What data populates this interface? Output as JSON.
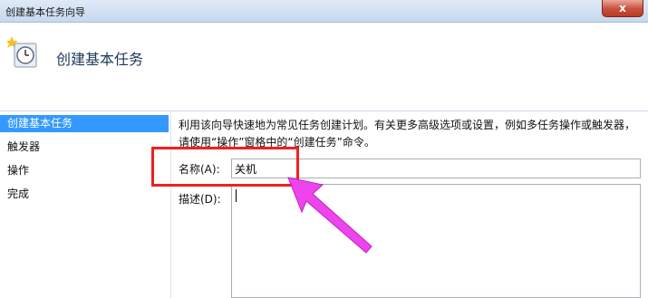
{
  "window": {
    "title": "创建基本任务向导",
    "close_label": "x"
  },
  "header": {
    "title": "创建基本任务",
    "icon": "clock-task-icon"
  },
  "sidebar": {
    "items": [
      {
        "label": "创建基本任务",
        "active": true
      },
      {
        "label": "触发器",
        "active": false
      },
      {
        "label": "操作",
        "active": false
      },
      {
        "label": "完成",
        "active": false
      }
    ]
  },
  "main": {
    "description": "利用该向导快速地为常见任务创建计划。有关更多高级选项或设置，例如多任务操作或触发器，请使用“操作”窗格中的“创建任务”命令。",
    "name_label": "名称(A):",
    "name_value": "关机",
    "desc_label": "描述(D):",
    "desc_value": ""
  },
  "annotation": {
    "highlight_color": "#ef2020",
    "arrow_color": "#ee44ee"
  }
}
